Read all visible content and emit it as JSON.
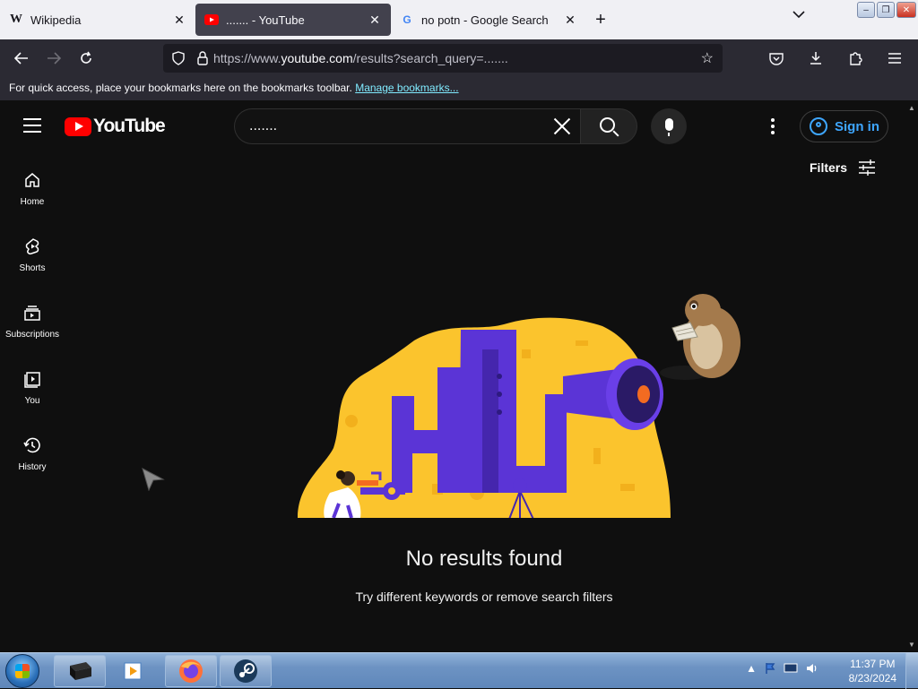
{
  "browser": {
    "tabs": [
      {
        "title": "Wikipedia",
        "favicon": "wikipedia-icon"
      },
      {
        "title": "....... - YouTube",
        "favicon": "youtube-icon",
        "active": true
      },
      {
        "title": "no potn - Google Search",
        "favicon": "google-icon"
      }
    ],
    "url_prefix": "https://www.",
    "url_domain": "youtube.com",
    "url_rest": "/results?search_query=.......",
    "bookmarks_prompt": "For quick access, place your bookmarks here on the bookmarks toolbar.",
    "bookmarks_link": "Manage bookmarks..."
  },
  "youtube": {
    "logo_text": "YouTube",
    "search_value": ".......",
    "sign_in": "Sign in",
    "filters": "Filters",
    "sidebar": [
      {
        "label": "Home",
        "icon": "home-icon"
      },
      {
        "label": "Shorts",
        "icon": "shorts-icon"
      },
      {
        "label": "Subscriptions",
        "icon": "subscriptions-icon"
      },
      {
        "label": "You",
        "icon": "you-icon"
      },
      {
        "label": "History",
        "icon": "history-icon"
      }
    ],
    "empty_title": "No results found",
    "empty_subtitle": "Try different keywords or remove search filters"
  },
  "taskbar": {
    "time": "11:37 PM",
    "date": "8/23/2024"
  },
  "colors": {
    "yt_bg": "#0f0f0f",
    "yt_red": "#ff0000",
    "link_blue": "#3ea6ff",
    "illus_yellow": "#fbc42d",
    "illus_purple": "#5b34d6"
  }
}
